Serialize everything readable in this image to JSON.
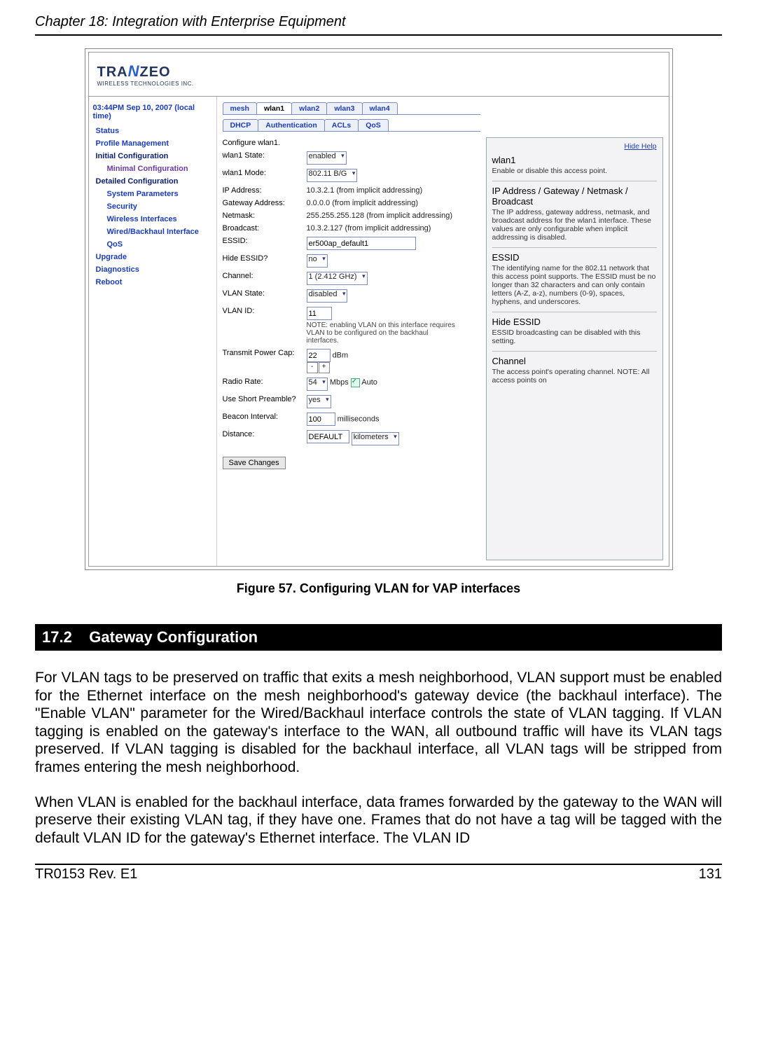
{
  "header": {
    "chapter": "Chapter 18: Integration with Enterprise Equipment"
  },
  "footer": {
    "left": "TR0153 Rev. E1",
    "right": "131"
  },
  "figure": {
    "caption": "Figure 57. Configuring VLAN for VAP interfaces"
  },
  "section": {
    "number": "17.2",
    "title": "Gateway Configuration"
  },
  "paragraphs": {
    "p1": "For VLAN tags to be preserved on traffic that exits a mesh neighborhood, VLAN support must be enabled for the Ethernet interface on the mesh neighborhood's gateway device (the backhaul interface). The \"Enable VLAN\" parameter for the Wired/Backhaul interface controls the state of VLAN tagging. If VLAN tagging is enabled on the gateway's interface to the WAN, all outbound traffic will have its VLAN tags preserved. If VLAN tagging is disabled for the backhaul interface, all VLAN tags will be stripped from frames entering the mesh neighborhood.",
    "p2": "When VLAN is enabled for the backhaul interface, data frames forwarded by the gateway to the WAN will preserve their existing VLAN tag, if they have one. Frames that do not have a tag will be tagged with the default VLAN ID for the gateway's Ethernet interface. The VLAN ID"
  },
  "app": {
    "logo_main_pre": "TRA",
    "logo_main_mid": "N",
    "logo_main_post": "ZEO",
    "logo_sub": "WIRELESS TECHNOLOGIES INC.",
    "time": "03:44PM Sep 10, 2007 (local time)",
    "sidebar": {
      "status": "Status",
      "profile": "Profile Management",
      "initial": "Initial Configuration",
      "minimal": "Minimal Configuration",
      "detailed": "Detailed Configuration",
      "sysparams": "System Parameters",
      "security": "Security",
      "wireless": "Wireless Interfaces",
      "wired": "Wired/Backhaul Interface",
      "qos": "QoS",
      "upgrade": "Upgrade",
      "diag": "Diagnostics",
      "reboot": "Reboot"
    },
    "tabs": {
      "mesh": "mesh",
      "wlan1": "wlan1",
      "wlan2": "wlan2",
      "wlan3": "wlan3",
      "wlan4": "wlan4"
    },
    "subtabs": {
      "dhcp": "DHCP",
      "auth": "Authentication",
      "acls": "ACLs",
      "qos": "QoS"
    },
    "form": {
      "intro": "Configure wlan1.",
      "labels": {
        "state": "wlan1 State:",
        "mode": "wlan1 Mode:",
        "ip": "IP Address:",
        "gateway": "Gateway Address:",
        "netmask": "Netmask:",
        "broadcast": "Broadcast:",
        "essid": "ESSID:",
        "hideessid": "Hide ESSID?",
        "channel": "Channel:",
        "vlanstate": "VLAN State:",
        "vlanid": "VLAN ID:",
        "txcap": "Transmit Power Cap:",
        "rate": "Radio Rate:",
        "preamble": "Use Short Preamble?",
        "beacon": "Beacon Interval:",
        "distance": "Distance:"
      },
      "values": {
        "state": "enabled",
        "mode": "802.11 B/G",
        "ip": "10.3.2.1 (from implicit addressing)",
        "gateway": "0.0.0.0 (from implicit addressing)",
        "netmask": "255.255.255.128 (from implicit addressing)",
        "broadcast": "10.3.2.127 (from implicit addressing)",
        "essid": "er500ap_default1",
        "hideessid": "no",
        "channel": "1 (2.412 GHz)",
        "vlanstate": "disabled",
        "vlanid": "11",
        "vlannote": "NOTE: enabling VLAN on this interface requires VLAN to be configured on the backhaul interfaces.",
        "txcap": "22",
        "txcap_unit": "dBm",
        "rate": "54",
        "rate_unit": "Mbps",
        "rate_auto": "Auto",
        "preamble": "yes",
        "beacon": "100",
        "beacon_unit": "milliseconds",
        "distance": "DEFAULT",
        "distance_unit": "kilometers"
      },
      "save": "Save Changes"
    },
    "help": {
      "hide": "Hide Help",
      "h1": "wlan1",
      "p1": "Enable or disable this access point.",
      "h2": "IP Address / Gateway / Netmask / Broadcast",
      "p2": "The IP address, gateway address, netmask, and broadcast address for the wlan1 interface. These values are only configurable when implicit addressing is disabled.",
      "h3": "ESSID",
      "p3": "The identifying name for the 802.11 network that this access point supports. The ESSID must be no longer than 32 characters and can only contain letters (A-Z, a-z), numbers (0-9), spaces, hyphens, and underscores.",
      "h4": "Hide ESSID",
      "p4": "ESSID broadcasting can be disabled with this setting.",
      "h5": "Channel",
      "p5": "The access point's operating channel. NOTE: All access points on"
    }
  }
}
